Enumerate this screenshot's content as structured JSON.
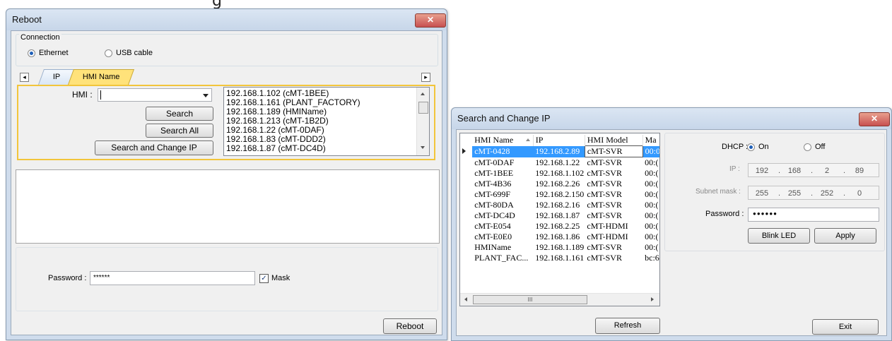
{
  "top_clip": "g",
  "reboot": {
    "title": "Reboot",
    "close_glyph": "✕",
    "connection": {
      "label": "Connection",
      "ethernet": "Ethernet",
      "usb": "USB cable",
      "selected": "Ethernet"
    },
    "tabs": {
      "left_arrow": "◂",
      "right_arrow": "▸",
      "ip": "IP",
      "hmi_name": "HMI Name",
      "active": "HMI Name"
    },
    "hmi_label": "HMI :",
    "hmi_value": "",
    "buttons": {
      "search": "Search",
      "search_all": "Search All",
      "search_change_ip": "Search and Change IP",
      "reboot": "Reboot"
    },
    "hmi_list": [
      "192.168.1.102 (cMT-1BEE)",
      "192.168.1.161 (PLANT_FACTORY)",
      "192.168.1.189 (HMIName)",
      "192.168.1.213 (cMT-1B2D)",
      "192.168.1.22 (cMT-0DAF)",
      "192.168.1.83 (cMT-DDD2)",
      "192.168.1.87 (cMT-DC4D)"
    ],
    "password_label": "Password :",
    "password_value": "******",
    "mask_label": "Mask",
    "mask_checked": true
  },
  "change_ip": {
    "title": "Search and Change IP",
    "close_glyph": "✕",
    "columns": [
      "HMI Name",
      "IP",
      "HMI Model",
      "Ma"
    ],
    "rows": [
      {
        "name": "cMT-0428",
        "ip": "192.168.2.89",
        "model": "cMT-SVR",
        "mac": "00:0"
      },
      {
        "name": "cMT-0DAF",
        "ip": "192.168.1.22",
        "model": "cMT-SVR",
        "mac": "00:("
      },
      {
        "name": "cMT-1BEE",
        "ip": "192.168.1.102",
        "model": "cMT-SVR",
        "mac": "00:("
      },
      {
        "name": "cMT-4B36",
        "ip": "192.168.2.26",
        "model": "cMT-SVR",
        "mac": "00:("
      },
      {
        "name": "cMT-699F",
        "ip": "192.168.2.150",
        "model": "cMT-SVR",
        "mac": "00:("
      },
      {
        "name": "cMT-80DA",
        "ip": "192.168.2.16",
        "model": "cMT-SVR",
        "mac": "00:("
      },
      {
        "name": "cMT-DC4D",
        "ip": "192.168.1.87",
        "model": "cMT-SVR",
        "mac": "00:("
      },
      {
        "name": "cMT-E054",
        "ip": "192.168.2.25",
        "model": "cMT-HDMI",
        "mac": "00:("
      },
      {
        "name": "cMT-E0E0",
        "ip": "192.168.1.86",
        "model": "cMT-HDMI",
        "mac": "00:("
      },
      {
        "name": "HMIName",
        "ip": "192.168.1.189",
        "model": "cMT-SVR",
        "mac": "00:("
      },
      {
        "name": "PLANT_FAC...",
        "ip": "192.168.1.161",
        "model": "cMT-SVR",
        "mac": "bc:6"
      }
    ],
    "scroll_glyph": "III",
    "dhcp_label": "DHCP :",
    "dhcp_on": "On",
    "dhcp_off": "Off",
    "dhcp_selected": "On",
    "ip_label": "IP :",
    "ip_parts": [
      "192",
      "168",
      "2",
      "89"
    ],
    "subnet_label": "Subnet mask :",
    "subnet_parts": [
      "255",
      "255",
      "252",
      "0"
    ],
    "password_label": "Password :",
    "password_value": "●●●●●●",
    "buttons": {
      "blink": "Blink LED",
      "apply": "Apply",
      "refresh": "Refresh",
      "exit": "Exit"
    }
  }
}
